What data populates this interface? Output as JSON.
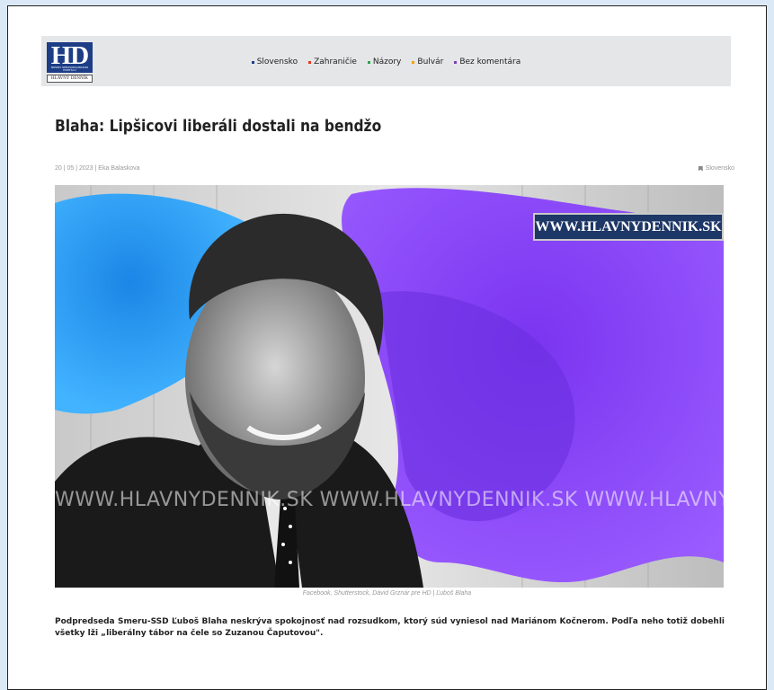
{
  "logo": {
    "text": "HD",
    "tagline": "NOVINY SPRAVODAJSKÉHO PORTÁLU",
    "subtext": "HLAVNÝ DENNÍK"
  },
  "nav": {
    "items": [
      {
        "label": "Slovensko",
        "color": "#1d3d86"
      },
      {
        "label": "Zahraničie",
        "color": "#e03a1e"
      },
      {
        "label": "Názory",
        "color": "#2aa24a"
      },
      {
        "label": "Bulvár",
        "color": "#f0a010"
      },
      {
        "label": "Bez komentára",
        "color": "#7a3fb0"
      }
    ]
  },
  "article": {
    "title": "Blaha: Lipšicovi liberáli dostali na bendžo",
    "meta": "20 | 05 | 2023 | Eka Balaskova",
    "category": "Slovensko",
    "image": {
      "watermark_box": "WWW.HLAVNYDENNIK.SK",
      "watermark_line": "WWW.HLAVNYDENNIK.SK WWW.HLAVNYDENNIK.SK WWW.HLAVNYDENNIK",
      "caption": "Facebook, Shutterstock, Dávid Grznár pre HD | Ľuboš Blaha"
    },
    "lead": "Podpredseda Smeru-SSD Ľuboš Blaha neskrýva spokojnosť nad rozsudkom, ktorý súd vyniesol nad Mariánom Kočnerom. Podľa neho totiž dobehli všetky lži „liberálny tábor na čele so Zuzanou Čaputovou\"."
  }
}
